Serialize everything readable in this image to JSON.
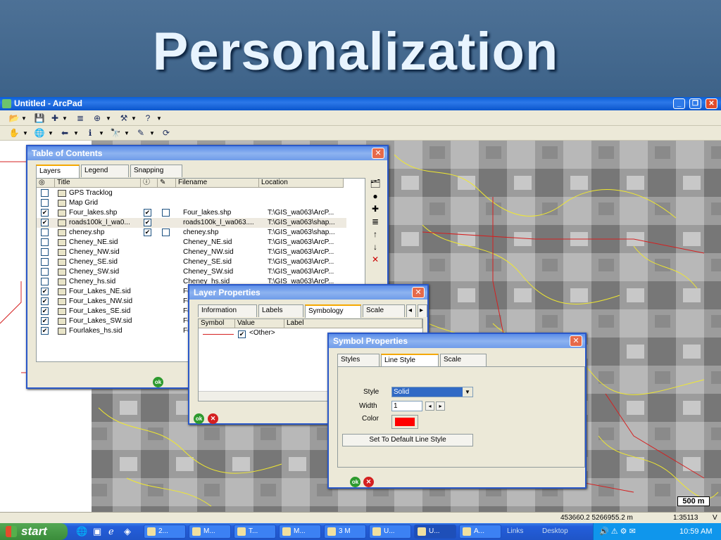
{
  "slide": {
    "title": "Personalization"
  },
  "window": {
    "title": "Untitled - ArcPad"
  },
  "map": {
    "coordinates": "453660.2  5266955.2 m",
    "scale": "1:35113",
    "units": "V",
    "scale_bar": "500 m"
  },
  "toc": {
    "title": "Table of Contents",
    "tabs": [
      "Layers",
      "Legend",
      "Snapping"
    ],
    "columns": [
      "Title",
      "Filename",
      "Location"
    ],
    "layers": [
      {
        "title": "GPS Tracklog",
        "filename": "",
        "location": "",
        "visible": false,
        "c2": null,
        "c3": null
      },
      {
        "title": "Map Grid",
        "filename": "",
        "location": "",
        "visible": false,
        "c2": null,
        "c3": null
      },
      {
        "title": "Four_lakes.shp",
        "filename": "Four_lakes.shp",
        "location": "T:\\GIS_wa063\\ArcP...",
        "visible": true,
        "c2": true,
        "c3": false
      },
      {
        "title": "roads100k_l_wa0...",
        "filename": "roads100k_l_wa063....",
        "location": "T:\\GIS_wa063\\shap...",
        "visible": true,
        "c2": true,
        "c3": null
      },
      {
        "title": "cheney.shp",
        "filename": "cheney.shp",
        "location": "T:\\GIS_wa063\\shap...",
        "visible": false,
        "c2": true,
        "c3": false
      },
      {
        "title": "Cheney_NE.sid",
        "filename": "Cheney_NE.sid",
        "location": "T:\\GIS_wa063\\ArcP...",
        "visible": false,
        "c2": null,
        "c3": null
      },
      {
        "title": "Cheney_NW.sid",
        "filename": "Cheney_NW.sid",
        "location": "T:\\GIS_wa063\\ArcP...",
        "visible": false,
        "c2": null,
        "c3": null
      },
      {
        "title": "Cheney_SE.sid",
        "filename": "Cheney_SE.sid",
        "location": "T:\\GIS_wa063\\ArcP...",
        "visible": false,
        "c2": null,
        "c3": null
      },
      {
        "title": "Cheney_SW.sid",
        "filename": "Cheney_SW.sid",
        "location": "T:\\GIS_wa063\\ArcP...",
        "visible": false,
        "c2": null,
        "c3": null
      },
      {
        "title": "Cheney_hs.sid",
        "filename": "Cheney_hs.sid",
        "location": "T:\\GIS_wa063\\ArcP...",
        "visible": false,
        "c2": null,
        "c3": null
      },
      {
        "title": "Four_Lakes_NE.sid",
        "filename": "Fo",
        "location": "",
        "visible": true,
        "c2": null,
        "c3": null
      },
      {
        "title": "Four_Lakes_NW.sid",
        "filename": "Fo",
        "location": "",
        "visible": true,
        "c2": null,
        "c3": null
      },
      {
        "title": "Four_Lakes_SE.sid",
        "filename": "Fo",
        "location": "",
        "visible": true,
        "c2": null,
        "c3": null
      },
      {
        "title": "Four_Lakes_SW.sid",
        "filename": "Fo",
        "location": "",
        "visible": true,
        "c2": null,
        "c3": null
      },
      {
        "title": "Fourlakes_hs.sid",
        "filename": "Fo",
        "location": "",
        "visible": true,
        "c2": null,
        "c3": null
      }
    ],
    "ok": "ok"
  },
  "layer_props": {
    "title": "Layer Properties",
    "tabs": [
      "Information",
      "Labels",
      "Symbology",
      "Scale"
    ],
    "columns": [
      "Symbol",
      "Value",
      "Label"
    ],
    "row_value": "<Other>"
  },
  "symbol_props": {
    "title": "Symbol Properties",
    "tabs": [
      "Styles",
      "Line Style",
      "Scale"
    ],
    "style_label": "Style",
    "style_value": "Solid",
    "width_label": "Width",
    "width_value": "1",
    "color_label": "Color",
    "color_value": "#ff0000",
    "default_button": "Set To Default Line Style"
  },
  "taskbar": {
    "start": "start",
    "tasks": [
      "2...",
      "M...",
      "T...",
      "M...",
      "3 M",
      "U...",
      "U...",
      "A..."
    ],
    "links": "Links",
    "desktop": "Desktop",
    "clock": "10:59 AM"
  }
}
